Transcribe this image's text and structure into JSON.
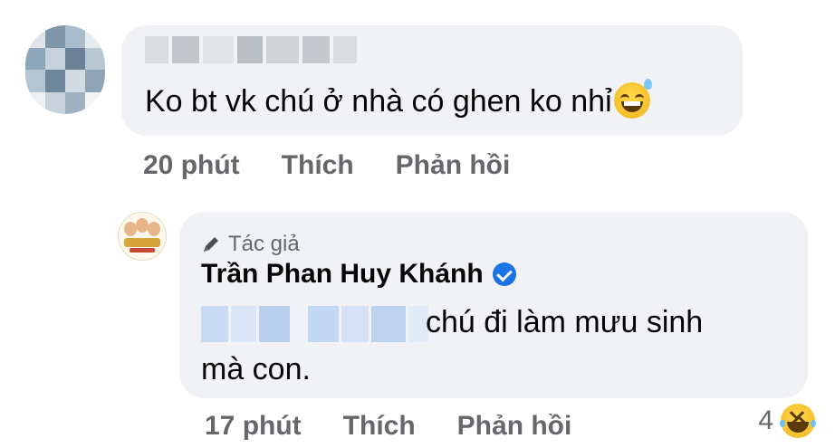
{
  "comment1": {
    "text": "Ko bt vk chú ở nhà có ghen ko nhỉ",
    "emoji": "grinning-sweat-emoji",
    "time": "20 phút",
    "like": "Thích",
    "reply": "Phản hồi"
  },
  "reply1": {
    "badge": "Tác giả",
    "author": "Trần Phan Huy Khánh",
    "text_line1": "chú đi làm mưu sinh",
    "text_line2": "mà con.",
    "time": "17 phút",
    "like": "Thích",
    "reply": "Phản hồi",
    "reaction_count": "4",
    "reaction_emoji": "laughing-emoji"
  },
  "colors": {
    "bubble": "#f0f2f5",
    "meta_text": "#65676b",
    "verified": "#1b74e4"
  }
}
